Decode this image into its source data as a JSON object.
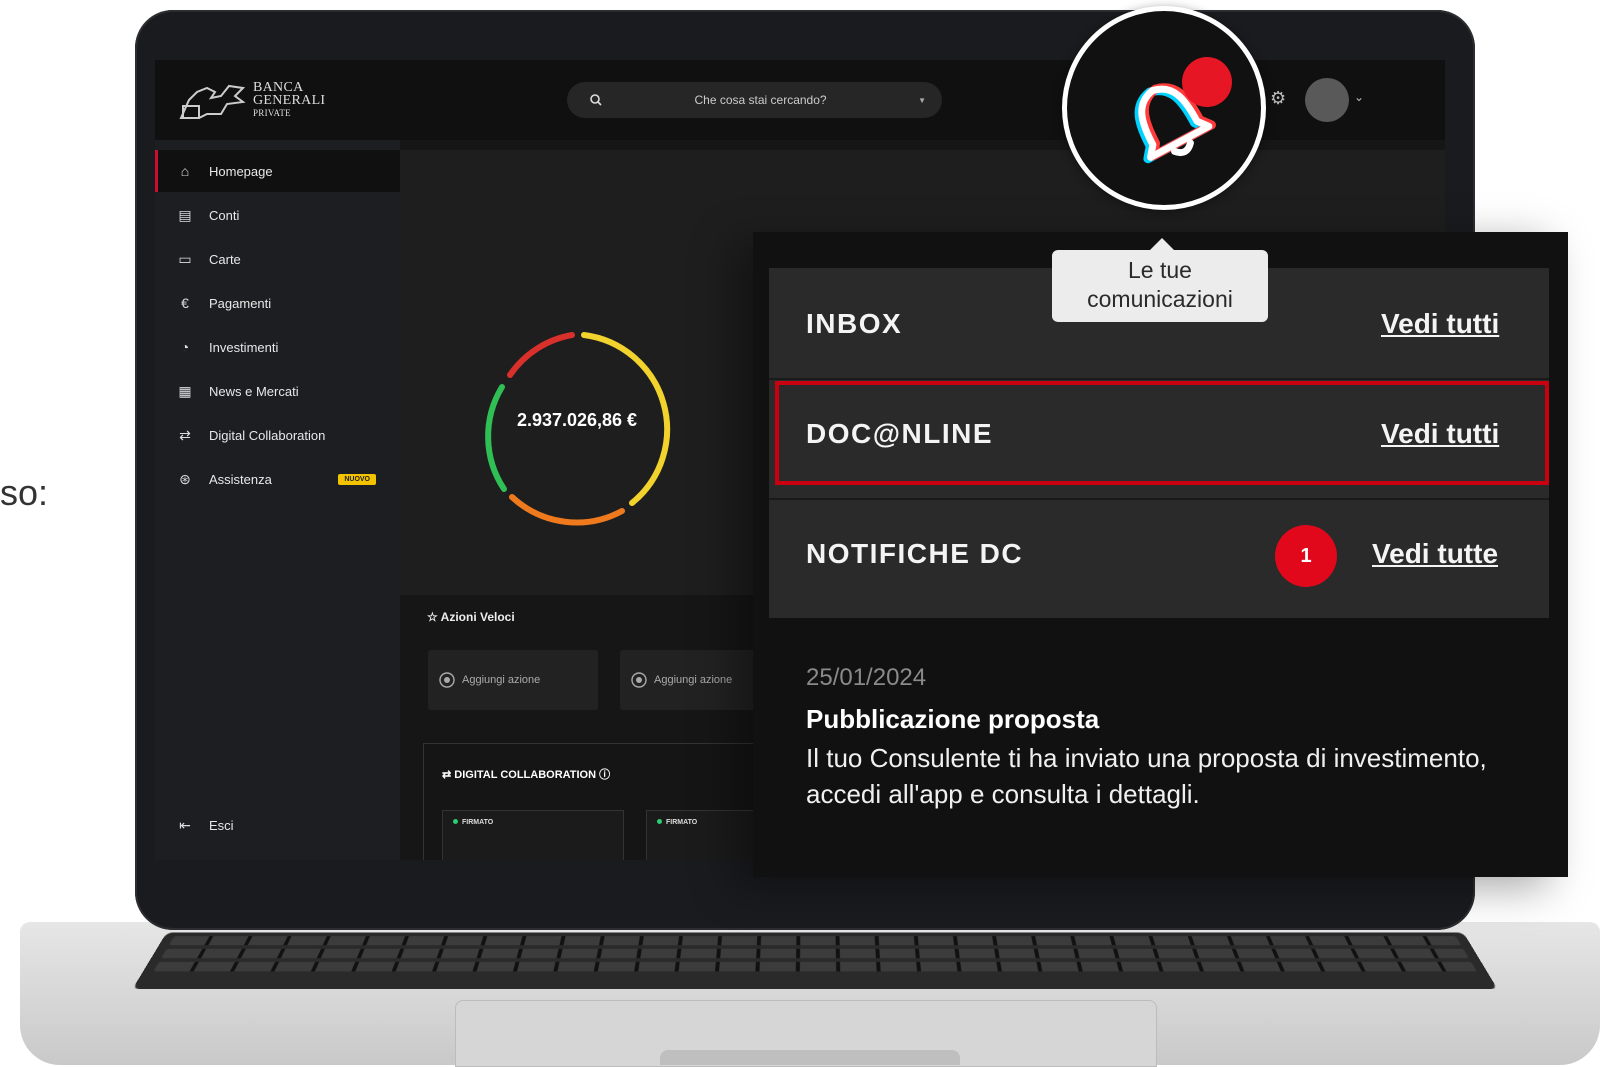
{
  "background": {
    "cut_text": "so:"
  },
  "app": {
    "logo": {
      "line1": "BANCA",
      "line2": "GENERALI",
      "line3": "PRIVATE"
    },
    "search": {
      "placeholder": "Che cosa stai cercando?"
    },
    "sidebar": {
      "items": [
        {
          "label": "Homepage",
          "icon": "home-icon",
          "active": true
        },
        {
          "label": "Conti",
          "icon": "database-icon"
        },
        {
          "label": "Carte",
          "icon": "card-icon"
        },
        {
          "label": "Pagamenti",
          "icon": "euro-icon"
        },
        {
          "label": "Investimenti",
          "icon": "pie-chart-icon"
        },
        {
          "label": "News e Mercati",
          "icon": "newspaper-icon"
        },
        {
          "label": "Digital Collaboration",
          "icon": "handshake-icon"
        },
        {
          "label": "Assistenza",
          "icon": "lifebuoy-icon",
          "badge": "NUOVO"
        }
      ],
      "logout": {
        "label": "Esci",
        "icon": "logout-icon"
      }
    },
    "portfolio": {
      "total": "2.937.026,86 €"
    },
    "quick_actions": {
      "title": "Azioni Veloci",
      "items": [
        "Aggiungi azione",
        "Aggiungi azione"
      ]
    },
    "digital_collaboration": {
      "title": "DIGITAL COLLABORATION",
      "cards": [
        {
          "status": "FIRMATO"
        },
        {
          "status": "FIRMATO"
        }
      ]
    }
  },
  "notifications": {
    "tooltip": {
      "line1": "Le tue",
      "line2": "comunicazioni"
    },
    "rows": [
      {
        "title": "INBOX",
        "link": "Vedi tutti"
      },
      {
        "title": "DOC@NLINE",
        "link": "Vedi tutti",
        "highlighted": true
      },
      {
        "title": "NOTIFICHE DC",
        "link": "Vedi tutte",
        "count": "1"
      }
    ],
    "message": {
      "date": "25/01/2024",
      "title": "Pubblicazione proposta",
      "body": "Il tuo Consulente ti ha inviato una proposta di investimento, accedi all'app e consulta i dettagli."
    }
  },
  "colors": {
    "brand_red": "#c8102e",
    "highlight_red": "#c8000f",
    "badge_red": "#e1081c",
    "new_badge_yellow": "#f3c300"
  }
}
